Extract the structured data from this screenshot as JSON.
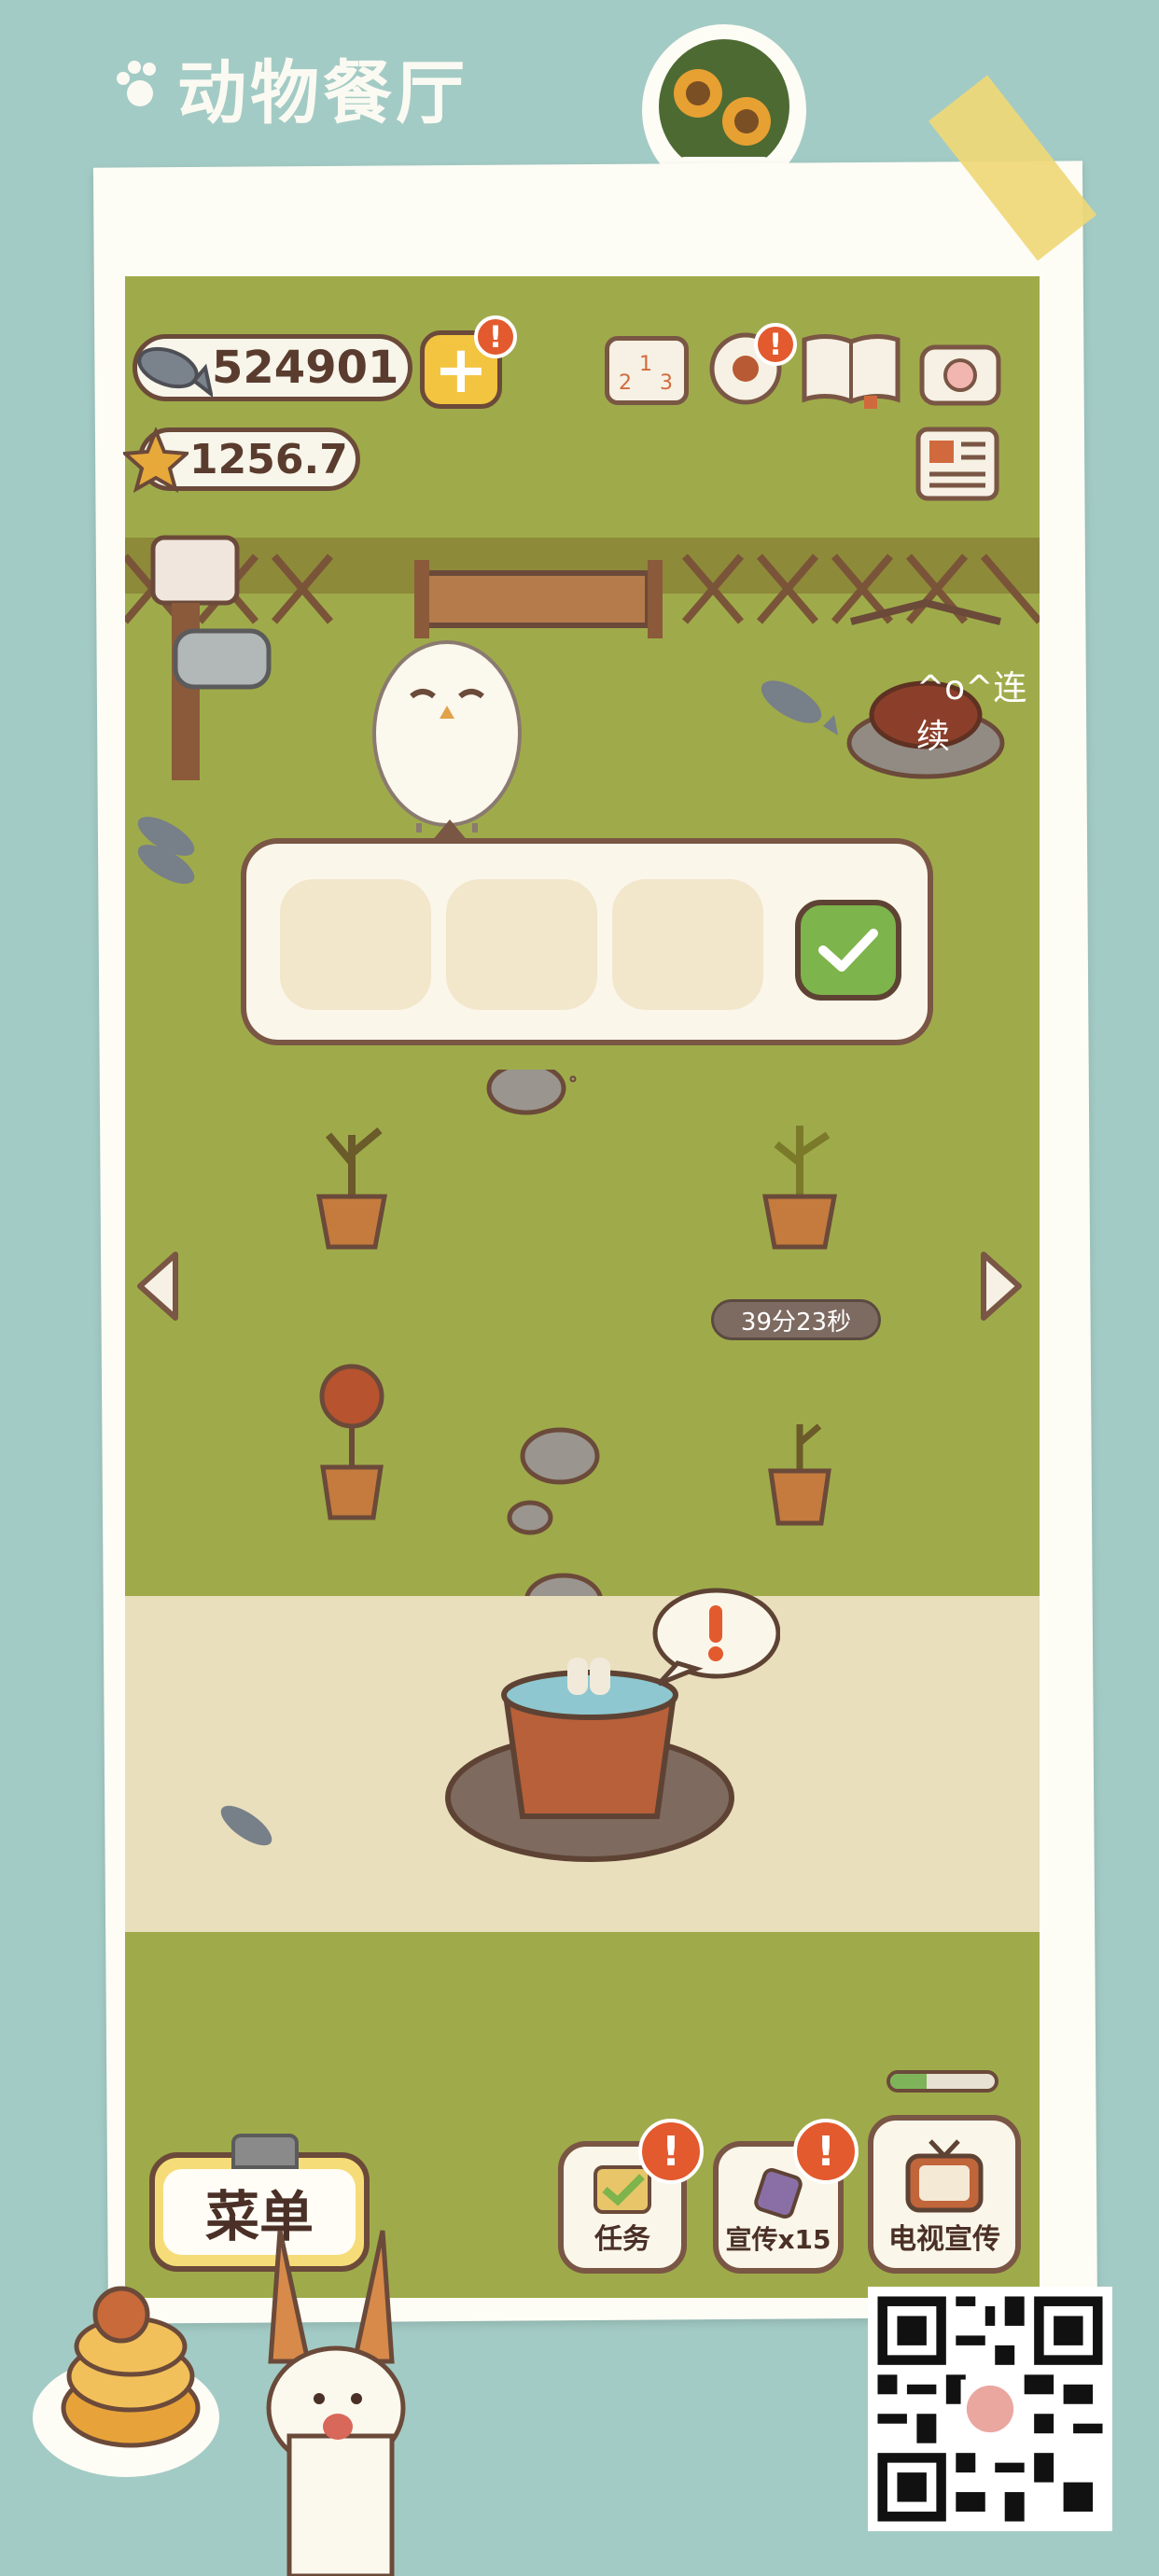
{
  "app": {
    "title": "动物餐厅"
  },
  "currency": {
    "fish": "524901",
    "stars": "1256.7",
    "add_label": "+"
  },
  "top_icons": {
    "ranking": "ranking-icon",
    "settings": "settings-icon",
    "book": "recipe-book-icon",
    "camera": "camera-icon",
    "news": "newspaper-icon"
  },
  "scene": {
    "chat_text": "^o^连续",
    "timer": "39分23秒",
    "alert_mark": "!"
  },
  "dialog": {
    "slots": [
      "empty-slot",
      "empty-slot",
      "empty-slot"
    ],
    "confirm_icon": "checkmark-icon"
  },
  "bottom_bar": {
    "menu": "菜单",
    "tasks": "任务",
    "promote": "宣传x15",
    "tv": "电视宣传",
    "tv_progress": 0.35,
    "badge": "!"
  },
  "colors": {
    "background": "#a3cbc5",
    "grass": "#9fab4a",
    "path": "#e9dfbc",
    "badge": "#e35a2e",
    "accent": "#f2c440"
  }
}
